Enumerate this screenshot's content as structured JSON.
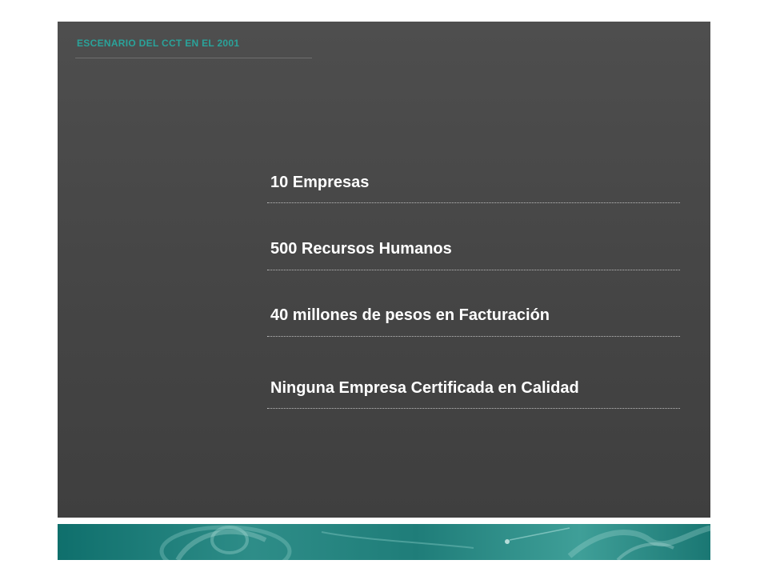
{
  "header": {
    "title": "ESCENARIO DEL CCT EN EL 2001"
  },
  "items": [
    {
      "text": "10  Empresas"
    },
    {
      "text": "500  Recursos Humanos"
    },
    {
      "text": "40 millones de pesos en Facturación"
    },
    {
      "text": "Ninguna Empresa Certificada en Calidad"
    }
  ],
  "colors": {
    "panel": "#474747",
    "accent": "#2aa39a",
    "footer": "#1f7d79",
    "text": "#ffffff"
  }
}
